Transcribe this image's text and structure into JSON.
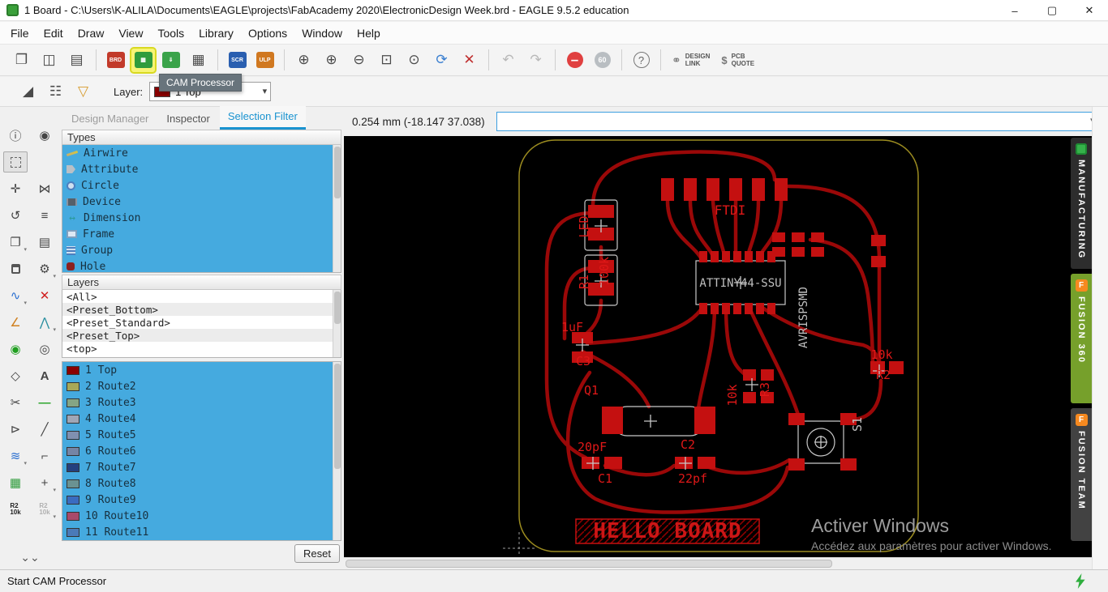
{
  "window": {
    "title": "1 Board - C:\\Users\\K-ALILA\\Documents\\EAGLE\\projects\\FabAcademy 2020\\ElectronicDesign Week.brd - EAGLE 9.5.2 education"
  },
  "menu": {
    "items": [
      "File",
      "Edit",
      "Draw",
      "View",
      "Tools",
      "Library",
      "Options",
      "Window",
      "Help"
    ]
  },
  "toolbar": {
    "tooltip": "CAM Processor",
    "board_icon_label": "BRD",
    "script_icon_label": "SCR",
    "ulp_icon_label": "ULP",
    "go_label": "60",
    "design_link": {
      "line1": "DESIGN",
      "line2": "LINK"
    },
    "pcb_quote": {
      "line1": "PCB",
      "line2": "QUOTE"
    }
  },
  "layerbar": {
    "label": "Layer:",
    "selected": "1 Top",
    "selected_color": "#8b0000"
  },
  "palette": {
    "value_top": "R2",
    "value_bottom": "10k"
  },
  "panel": {
    "tabs": {
      "design_manager": "Design Manager",
      "inspector": "Inspector",
      "selection_filter": "Selection Filter"
    },
    "types_header": "Types",
    "types": [
      {
        "label": "Airwire"
      },
      {
        "label": "Attribute"
      },
      {
        "label": "Circle"
      },
      {
        "label": "Device"
      },
      {
        "label": "Dimension"
      },
      {
        "label": "Frame"
      },
      {
        "label": "Group"
      },
      {
        "label": "Hole"
      }
    ],
    "layers_header": "Layers",
    "presets": [
      "<All>",
      "<Preset_Bottom>",
      "<Preset_Standard>",
      "<Preset_Top>",
      "<top>"
    ],
    "layers": [
      {
        "label": "1 Top",
        "color": "#8b0000"
      },
      {
        "label": "2 Route2",
        "color": "#a8a858"
      },
      {
        "label": "3 Route3",
        "color": "#85a585"
      },
      {
        "label": "4 Route4",
        "color": "#9fa6b6"
      },
      {
        "label": "5 Route5",
        "color": "#8090b0"
      },
      {
        "label": "6 Route6",
        "color": "#7585a5"
      },
      {
        "label": "7 Route7",
        "color": "#24407e"
      },
      {
        "label": "8 Route8",
        "color": "#6a9292"
      },
      {
        "label": "9 Route9",
        "color": "#3a6cc0"
      },
      {
        "label": "10 Route10",
        "color": "#a84a6a"
      },
      {
        "label": "11 Route11",
        "color": "#4a7ab8"
      }
    ],
    "reset_label": "Reset"
  },
  "command_bar": {
    "coords": "0.254 mm (-18.147 37.038)",
    "input_value": ""
  },
  "board": {
    "labels": {
      "led": "LED",
      "r1": "R1",
      "r1_value": "100k",
      "ftdi": "FTDI",
      "ic": "ATTINY44-SSU",
      "isp": "AVRISPSMD",
      "c_bypass": "1uF",
      "c3": "C3",
      "r2_value": "10k",
      "r2": "R2",
      "q1": "Q1",
      "r3_value": "10k",
      "r3": "R3",
      "c1": "C1",
      "c1_value": "20pF",
      "c2": "C2",
      "c2_value": "22pf",
      "s1": "S1",
      "hello": "HELLO BOARD"
    }
  },
  "watermark": {
    "line1": "Activer Windows",
    "line2": "Accédez aux paramètres pour activer Windows."
  },
  "side_tabs": {
    "manufacturing": "MANUFACTURING",
    "fusion360": "FUSION 360",
    "fusion_team": "FUSION TEAM"
  },
  "status": {
    "text": "Start CAM Processor"
  }
}
